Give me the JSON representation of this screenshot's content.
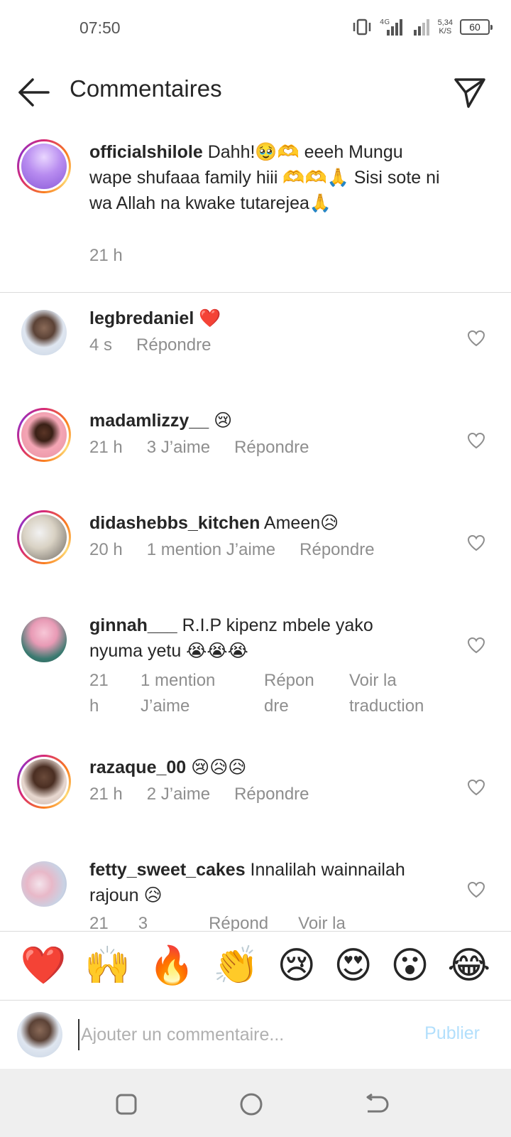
{
  "status_bar": {
    "time": "07:50",
    "network": "4G",
    "speed_value": "5,34",
    "speed_unit": "K/S",
    "battery": "60"
  },
  "header": {
    "title": "Commentaires"
  },
  "caption": {
    "username": "officialshilole",
    "text": " Dahh!🥹🫶 eeeh Mungu wape shufaaa family hiii 🫶🫶🙏 Sisi sote ni wa Allah na kwake tutarejea🙏",
    "time": "21 h"
  },
  "comments": [
    {
      "username": "legbredaniel",
      "text": " ❤️",
      "time": "4 s",
      "reply": "Répondre"
    },
    {
      "username": "madamlizzy__",
      "text": " 😢",
      "time": "21 h",
      "likes": "3 J’aime",
      "reply": "Répondre"
    },
    {
      "username": "didashebbs_kitchen",
      "text": " Ameen😥",
      "time": "20 h",
      "likes": "1 mention J’aime",
      "reply": "Répondre"
    },
    {
      "username": "ginnah___",
      "text": " R.I.P kipenz mbele yako nyuma yetu 😭😭😭",
      "time_l1": "21",
      "time_l2": "h",
      "likes_l1": "1 mention",
      "likes_l2": "J’aime",
      "reply_l1": "Répon",
      "reply_l2": "dre",
      "translate_l1": "Voir la",
      "translate_l2": "traduction"
    },
    {
      "username": "razaque_00",
      "text": " 😢😥😥",
      "time": "21 h",
      "likes": "2 J’aime",
      "reply": "Répondre"
    },
    {
      "username": "fetty_sweet_cakes",
      "text": " Innalilah wainnailah rajoun 😥",
      "time": "21",
      "likes": "3",
      "reply": "Répond",
      "translate": "Voir la"
    }
  ],
  "emoji_bar": [
    "❤️",
    "🙌",
    "🔥",
    "👏",
    "😢",
    "😍",
    "😮",
    "😂"
  ],
  "composer": {
    "placeholder": "Ajouter un commentaire...",
    "publish_label": "Publier"
  },
  "colors": {
    "publish": "#b2dffc",
    "meta": "#8e8e8e",
    "text": "#262626",
    "divider": "#dbdbdb"
  }
}
